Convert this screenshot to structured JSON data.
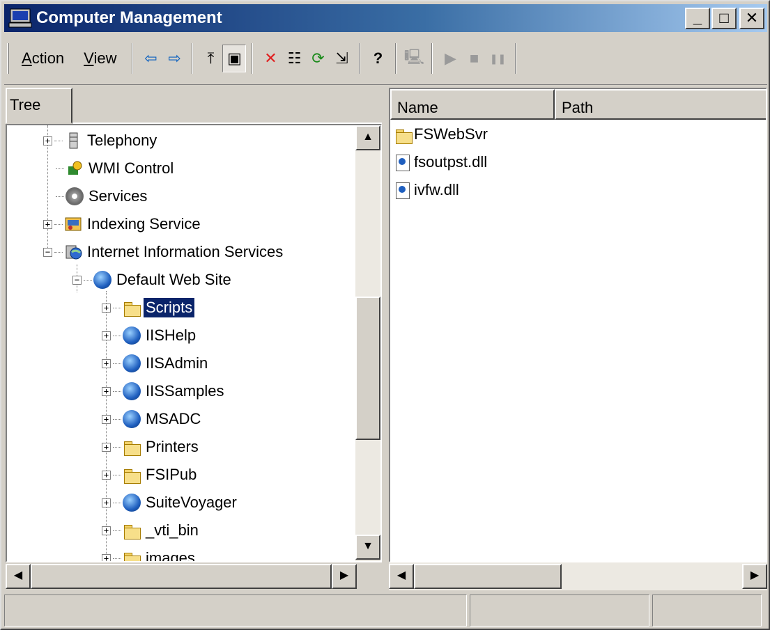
{
  "window": {
    "title": "Computer Management"
  },
  "titlebar": {
    "minimize": "_",
    "maximize": "□",
    "close": "✕"
  },
  "menu": {
    "action": {
      "accel": "A",
      "rest": "ction"
    },
    "view": {
      "accel": "V",
      "rest": "iew"
    }
  },
  "toolbar": {
    "back": "⇦",
    "forward": "⇨",
    "up": "⤒",
    "show_hide_tree": "▣",
    "delete": "✕",
    "properties": "☷",
    "refresh": "⟳",
    "export": "⇲",
    "help": "?",
    "connect": "🖳",
    "start": "▶",
    "stop": "■",
    "pause": "❚❚"
  },
  "tree": {
    "tab_label": "Tree",
    "items": [
      {
        "label": "Telephony",
        "expander": "+"
      },
      {
        "label": "WMI Control"
      },
      {
        "label": "Services"
      },
      {
        "label": "Indexing Service",
        "expander": "+"
      },
      {
        "label": "Internet Information Services",
        "expander": "−"
      },
      {
        "label": "Default Web Site",
        "expander": "−"
      },
      {
        "label": "Scripts",
        "expander": "+",
        "selected": true
      },
      {
        "label": "IISHelp",
        "expander": "+"
      },
      {
        "label": "IISAdmin",
        "expander": "+"
      },
      {
        "label": "IISSamples",
        "expander": "+"
      },
      {
        "label": "MSADC",
        "expander": "+"
      },
      {
        "label": "Printers",
        "expander": "+"
      },
      {
        "label": "FSIPub",
        "expander": "+"
      },
      {
        "label": "SuiteVoyager",
        "expander": "+"
      },
      {
        "label": "_vti_bin",
        "expander": "+"
      },
      {
        "label": "images",
        "expander": "+"
      }
    ]
  },
  "list": {
    "columns": [
      "Name",
      "Path"
    ],
    "items": [
      {
        "name": "FSWebSvr",
        "icon": "folder-icon"
      },
      {
        "name": "fsoutpst.dll",
        "icon": "dll-file-icon"
      },
      {
        "name": "ivfw.dll",
        "icon": "dll-file-icon"
      }
    ]
  },
  "scroll": {
    "up": "▲",
    "down": "▼",
    "left": "◀",
    "right": "▶"
  },
  "status": {
    "panel1": "",
    "panel2": "",
    "panel3": ""
  },
  "colors": {
    "titlebar_start": "#0a246a",
    "titlebar_end": "#a6caf0",
    "selection": "#0a246a",
    "face": "#d4d0c8"
  }
}
